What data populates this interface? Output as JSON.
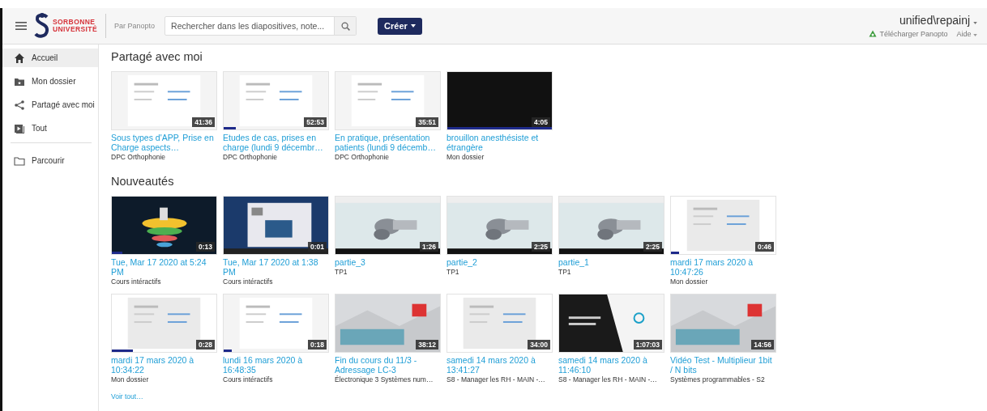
{
  "header": {
    "logo": {
      "line1": "SORBONNE",
      "line2": "UNIVERSITÉ"
    },
    "powered_by": "Par Panopto",
    "search": {
      "placeholder": "Rechercher dans les diapositives, note..."
    },
    "create_button": "Créer",
    "user": "unified\\repainj",
    "download_link": "Télécharger Panopto",
    "help_menu": "Aide"
  },
  "sidebar": {
    "sections": [
      {
        "items": [
          {
            "label": "Accueil",
            "selected": true
          },
          {
            "label": "Mon dossier",
            "selected": false
          },
          {
            "label": "Partagé avec moi",
            "selected": false
          },
          {
            "label": "Tout",
            "selected": false
          }
        ]
      },
      {
        "items": [
          {
            "label": "Parcourir",
            "selected": false
          }
        ]
      }
    ]
  },
  "sections": [
    {
      "title": "Partagé avec moi",
      "videos": [
        {
          "title": "Sous types d'APP, Prise en Charge aspects…",
          "folder": "DPC Orthophonie",
          "duration": "41:36"
        },
        {
          "title": "Etudes de cas, prises en charge (lundi 9 décembr…",
          "folder": "DPC Orthophonie",
          "duration": "52:53",
          "level": 0.12
        },
        {
          "title": "En pratique, présentation patients (lundi 9 décemb…",
          "folder": "DPC Orthophonie",
          "duration": "35:51"
        },
        {
          "title": "brouillon anesthésiste et étrangère",
          "folder": "Mon dossier",
          "duration": "4:05",
          "level": 1
        }
      ]
    },
    {
      "title": "Nouveautés",
      "videos": [
        {
          "title": "Tue, Mar 17 2020 at 5:24 PM",
          "folder": "Cours intéractifs",
          "duration": "0:13",
          "level": 0.1
        },
        {
          "title": "Tue, Mar 17 2020 at 1:38 PM",
          "folder": "Cours intéractifs",
          "duration": "0:01"
        },
        {
          "title": "partie_3",
          "folder": "TP1",
          "duration": "1:26"
        },
        {
          "title": "partie_2",
          "folder": "TP1",
          "duration": "2:25"
        },
        {
          "title": "partie_1",
          "folder": "TP1",
          "duration": "2:25"
        },
        {
          "title": "mardi 17 mars 2020 à 10:47:26",
          "folder": "Mon dossier",
          "duration": "0:46",
          "level": 0.08
        },
        {
          "title": "mardi 17 mars 2020 à 10:34:22",
          "folder": "Mon dossier",
          "duration": "0:28",
          "level": 0.2
        },
        {
          "title": "lundi 16 mars 2020 à 16:48:35",
          "folder": "Cours intéractifs",
          "duration": "0:18",
          "level": 0.08
        },
        {
          "title": "Fin du cours du 11/3 - Adressage LC-3",
          "folder": "Électronique 3 Systèmes num…",
          "duration": "38:12"
        },
        {
          "title": "samedi 14 mars 2020 à 13:41:27",
          "folder": "S8 - Manager les RH - MAIN -…",
          "duration": "34:00"
        },
        {
          "title": "samedi 14 mars 2020 à 11:46:10",
          "folder": "S8 - Manager les RH - MAIN -…",
          "duration": "1:07:03"
        },
        {
          "title": "Vidéo Test - Multiplieur 1bit / N bits",
          "folder": "Systèmes programmables - S2",
          "duration": "14:56"
        }
      ],
      "more_link": "Voir tout…"
    }
  ]
}
